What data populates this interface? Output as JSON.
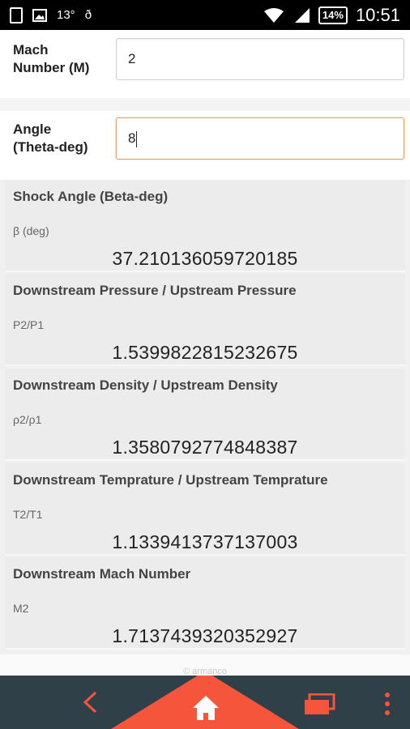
{
  "status_bar": {
    "temperature": "13°",
    "misc_glyph": "ð",
    "battery": "14%",
    "time": "10:51",
    "icons": [
      "sim-icon",
      "image-icon",
      "wifi-icon",
      "signal-icon",
      "battery-icon"
    ]
  },
  "inputs": [
    {
      "label_line1": "Mach",
      "label_line2": "Number (M)",
      "value": "2"
    },
    {
      "label_line1": "Angle",
      "label_line2": "(Theta-deg)",
      "value": "8"
    }
  ],
  "results": [
    {
      "title": "Shock Angle (Beta-deg)",
      "symbol": "β (deg)",
      "value": "37.210136059720185"
    },
    {
      "title": "Downstream Pressure / Upstream Pressure",
      "symbol": "P2/P1",
      "value": "1.5399822815232675"
    },
    {
      "title": "Downstream Density / Upstream Density",
      "symbol": "ρ2/ρ1",
      "value": "1.3580792774848387"
    },
    {
      "title": "Downstream Temprature / Upstream Temprature",
      "symbol": "T2/T1",
      "value": "1.1339413737137003"
    },
    {
      "title": "Downstream Mach Number",
      "symbol": "M2",
      "value": "1.7137439320352927"
    }
  ],
  "footer": {
    "text": "© armanco"
  },
  "colors": {
    "accent": "#f4553b",
    "navbar": "#2f4049",
    "focus_border": "#f0a04b"
  }
}
